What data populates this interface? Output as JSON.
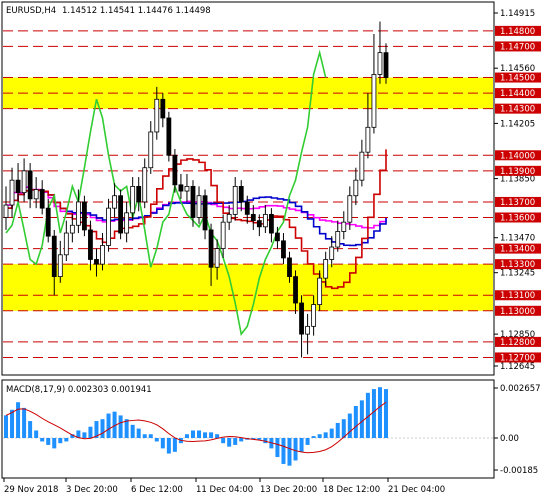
{
  "header": {
    "symbol": "EURUSD,H4",
    "ohlc": "1.14512 1.14541 1.14476 1.14498"
  },
  "macd": {
    "label": "MACD(8,17,9) 0.002303 0.001941",
    "ticks": [
      {
        "text": "0.002657",
        "v": 0.002657
      },
      {
        "text": "0.00",
        "v": 0.0
      },
      {
        "text": "-0.00185",
        "v": -0.00185
      }
    ],
    "histogram": [
      0.0012,
      0.0015,
      0.0019,
      0.0016,
      0.0009,
      0.0004,
      -0.0002,
      -0.0004,
      -0.0006,
      -0.0003,
      -0.0002,
      0.0002,
      0.0004,
      0.0003,
      0.0006,
      0.0009,
      0.001,
      0.0013,
      0.0014,
      0.0012,
      0.001,
      0.0007,
      0.0005,
      0.0002,
      0.0002,
      -0.0002,
      -0.0006,
      -0.0009,
      -0.0008,
      -0.0003,
      0.0002,
      0.0004,
      0.0004,
      0.0003,
      0.0003,
      0.0002,
      -0.0003,
      -0.0005,
      -0.0004,
      -0.0002,
      -0.0001,
      0.0,
      -0.0001,
      -0.0003,
      -0.0006,
      -0.0011,
      -0.0015,
      -0.0016,
      -0.0013,
      -0.0008,
      -0.0004,
      0.0001,
      0.0002,
      0.0003,
      0.0005,
      0.0008,
      0.001,
      0.0013,
      0.0017,
      0.002,
      0.0024,
      0.0026,
      0.0027,
      0.0026
    ]
  },
  "price_axis": {
    "ticks": [
      "1.14915",
      "1.14560",
      "1.14205",
      "1.13850",
      "1.13470",
      "1.13245",
      "1.12850",
      "1.12645"
    ],
    "tick_values": [
      1.14915,
      1.1456,
      1.14205,
      1.1385,
      1.1347,
      1.13245,
      1.1285,
      1.12645
    ]
  },
  "levels": [
    {
      "price": 1.148,
      "text": "1.14800"
    },
    {
      "price": 1.147,
      "text": "1.14700"
    },
    {
      "price": 1.145,
      "text": "1.14500"
    },
    {
      "price": 1.144,
      "text": "1.14400"
    },
    {
      "price": 1.143,
      "text": "1.14300"
    },
    {
      "price": 1.14,
      "text": "1.14000"
    },
    {
      "price": 1.139,
      "text": "1.13900"
    },
    {
      "price": 1.137,
      "text": "1.13700"
    },
    {
      "price": 1.136,
      "text": "1.13600"
    },
    {
      "price": 1.134,
      "text": "1.13400"
    },
    {
      "price": 1.133,
      "text": "1.13300"
    },
    {
      "price": 1.131,
      "text": "1.13100"
    },
    {
      "price": 1.13,
      "text": "1.13000"
    },
    {
      "price": 1.128,
      "text": "1.12800"
    },
    {
      "price": 1.127,
      "text": "1.12700"
    }
  ],
  "zones": [
    {
      "from": 1.143,
      "to": 1.145
    },
    {
      "from": 1.13,
      "to": 1.133
    }
  ],
  "time_axis": [
    {
      "text": "29 Nov 2018"
    },
    {
      "text": "3 Dec 20:00"
    },
    {
      "text": "6 Dec 12:00"
    },
    {
      "text": "11 Dec 04:00"
    },
    {
      "text": "13 Dec 20:00"
    },
    {
      "text": "18 Dec 12:00"
    },
    {
      "text": "21 Dec 04:00"
    }
  ],
  "colors": {
    "level_line": "#cc0000",
    "level_label_bg": "#cc0000",
    "zone": "#ffff00",
    "candles": "#000000",
    "macd_hist": "#1e90ff",
    "macd_signal": "#cc0000",
    "tenkan": "#cc0000",
    "kijun": "#0000cc",
    "ma": "#ff00ff",
    "chikou": "#32cd32",
    "bands": "#32cd32",
    "cloud": "#f4a460"
  },
  "closes": [
    1.1368,
    1.1384,
    1.1376,
    1.139,
    1.1372,
    1.1378,
    1.1366,
    1.1348,
    1.1322,
    1.1336,
    1.135,
    1.1355,
    1.137,
    1.1352,
    1.1333,
    1.133,
    1.1342,
    1.1366,
    1.1374,
    1.135,
    1.1363,
    1.138,
    1.137,
    1.1392,
    1.1415,
    1.1436,
    1.1424,
    1.14,
    1.1381,
    1.1377,
    1.138,
    1.136,
    1.1374,
    1.1352,
    1.1328,
    1.134,
    1.1357,
    1.1362,
    1.138,
    1.137,
    1.1362,
    1.1358,
    1.1354,
    1.1362,
    1.135,
    1.1345,
    1.1334,
    1.1322,
    1.1305,
    1.1285,
    1.129,
    1.1304,
    1.1321,
    1.1333,
    1.1341,
    1.1351,
    1.1357,
    1.1374,
    1.1384,
    1.1402,
    1.1418,
    1.1452,
    1.1466,
    1.145
  ],
  "opens": [
    1.136,
    1.1368,
    1.1384,
    1.1376,
    1.139,
    1.1372,
    1.1378,
    1.1366,
    1.1348,
    1.1322,
    1.1336,
    1.135,
    1.1355,
    1.137,
    1.1352,
    1.1333,
    1.133,
    1.1342,
    1.1366,
    1.1374,
    1.135,
    1.1363,
    1.138,
    1.137,
    1.1392,
    1.1415,
    1.1436,
    1.1424,
    1.14,
    1.1381,
    1.1377,
    1.138,
    1.136,
    1.1374,
    1.1352,
    1.1328,
    1.134,
    1.1357,
    1.1362,
    1.138,
    1.137,
    1.1362,
    1.1358,
    1.1354,
    1.1362,
    1.135,
    1.1345,
    1.1334,
    1.1322,
    1.1305,
    1.1285,
    1.129,
    1.1304,
    1.1321,
    1.1333,
    1.1341,
    1.1351,
    1.1357,
    1.1374,
    1.1384,
    1.1402,
    1.1418,
    1.1452,
    1.1466
  ],
  "highs": [
    1.138,
    1.1392,
    1.1395,
    1.1398,
    1.1395,
    1.1386,
    1.1384,
    1.1372,
    1.1352,
    1.1345,
    1.1358,
    1.1362,
    1.1378,
    1.1374,
    1.1358,
    1.134,
    1.135,
    1.1372,
    1.1382,
    1.1378,
    1.137,
    1.1386,
    1.1386,
    1.1398,
    1.1422,
    1.1444,
    1.144,
    1.1428,
    1.1404,
    1.1388,
    1.1388,
    1.1384,
    1.138,
    1.1378,
    1.1356,
    1.1346,
    1.1362,
    1.1368,
    1.1386,
    1.1384,
    1.1374,
    1.1368,
    1.1362,
    1.1368,
    1.1366,
    1.1354,
    1.135,
    1.1338,
    1.1326,
    1.131,
    1.1298,
    1.131,
    1.1326,
    1.1338,
    1.1348,
    1.1358,
    1.1364,
    1.138,
    1.1392,
    1.141,
    1.144,
    1.1478,
    1.1486,
    1.1472
  ],
  "lows": [
    1.1352,
    1.136,
    1.137,
    1.137,
    1.1366,
    1.1366,
    1.1362,
    1.1344,
    1.131,
    1.1318,
    1.1332,
    1.1344,
    1.135,
    1.1348,
    1.1326,
    1.1322,
    1.1326,
    1.1338,
    1.136,
    1.1346,
    1.1344,
    1.1358,
    1.1364,
    1.1366,
    1.1388,
    1.141,
    1.1418,
    1.1396,
    1.1376,
    1.1372,
    1.137,
    1.1354,
    1.1356,
    1.1346,
    1.1316,
    1.132,
    1.1334,
    1.1352,
    1.1358,
    1.1364,
    1.1356,
    1.1352,
    1.1348,
    1.135,
    1.1344,
    1.134,
    1.133,
    1.1318,
    1.1298,
    1.127,
    1.1272,
    1.1284,
    1.13,
    1.1316,
    1.1328,
    1.1338,
    1.1346,
    1.1352,
    1.1368,
    1.138,
    1.1398,
    1.1414,
    1.1446,
    1.1446
  ]
}
